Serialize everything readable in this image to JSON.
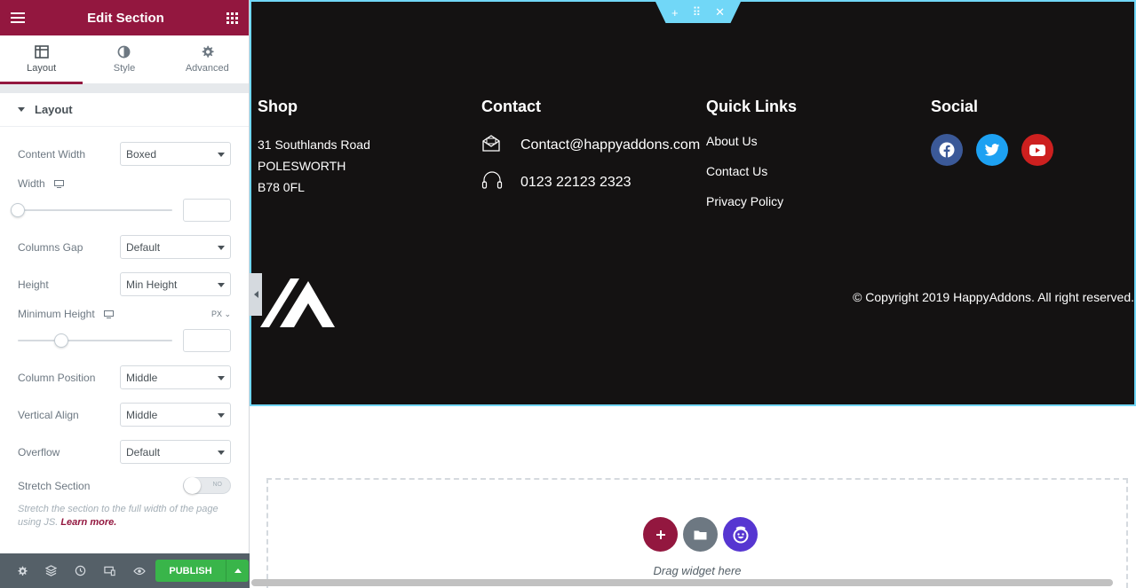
{
  "panel": {
    "title": "Edit Section",
    "tabs": [
      {
        "label": "Layout",
        "icon": "layout-icon",
        "active": true
      },
      {
        "label": "Style",
        "icon": "contrast-icon",
        "active": false
      },
      {
        "label": "Advanced",
        "icon": "gear-icon",
        "active": false
      }
    ],
    "section_title": "Layout",
    "controls": {
      "content_width": {
        "label": "Content Width",
        "value": "Boxed"
      },
      "width": {
        "label": "Width",
        "slider_fraction": 0
      },
      "columns_gap": {
        "label": "Columns Gap",
        "value": "Default"
      },
      "height": {
        "label": "Height",
        "value": "Min Height"
      },
      "minimum_height": {
        "label": "Minimum Height",
        "unit": "PX",
        "slider_fraction": 0.28
      },
      "column_position": {
        "label": "Column Position",
        "value": "Middle"
      },
      "vertical_align": {
        "label": "Vertical Align",
        "value": "Middle"
      },
      "overflow": {
        "label": "Overflow",
        "value": "Default"
      },
      "stretch_section": {
        "label": "Stretch Section",
        "toggle_text": "NO"
      }
    },
    "description": "Stretch the section to the full width of the page using JS.",
    "learn_more": "Learn more.",
    "footer": {
      "publish_label": "PUBLISH"
    }
  },
  "canvas": {
    "handle": {
      "add": "+",
      "move": "⠿",
      "close": "✕"
    },
    "shop": {
      "heading": "Shop",
      "lines": [
        "31 Southlands Road",
        "POLESWORTH",
        "B78 0FL"
      ]
    },
    "contact": {
      "heading": "Contact",
      "email": "Contact@happyaddons.com",
      "phone": "0123 22123 2323"
    },
    "quick_links": {
      "heading": "Quick Links",
      "items": [
        "About Us",
        "Contact Us",
        "Privacy Policy"
      ]
    },
    "social": {
      "heading": "Social",
      "colors": {
        "facebook": "#3b5998",
        "twitter": "#1da1f2",
        "youtube": "#cd201f"
      }
    },
    "copyright": "© Copyright 2019 HappyAddons. All right reserved.",
    "drop_zone": {
      "text": "Drag widget here"
    }
  },
  "colors": {
    "brand": "#93173f",
    "handle": "#71d7f7",
    "publish": "#39b54a",
    "footer_bg": "#141212"
  }
}
